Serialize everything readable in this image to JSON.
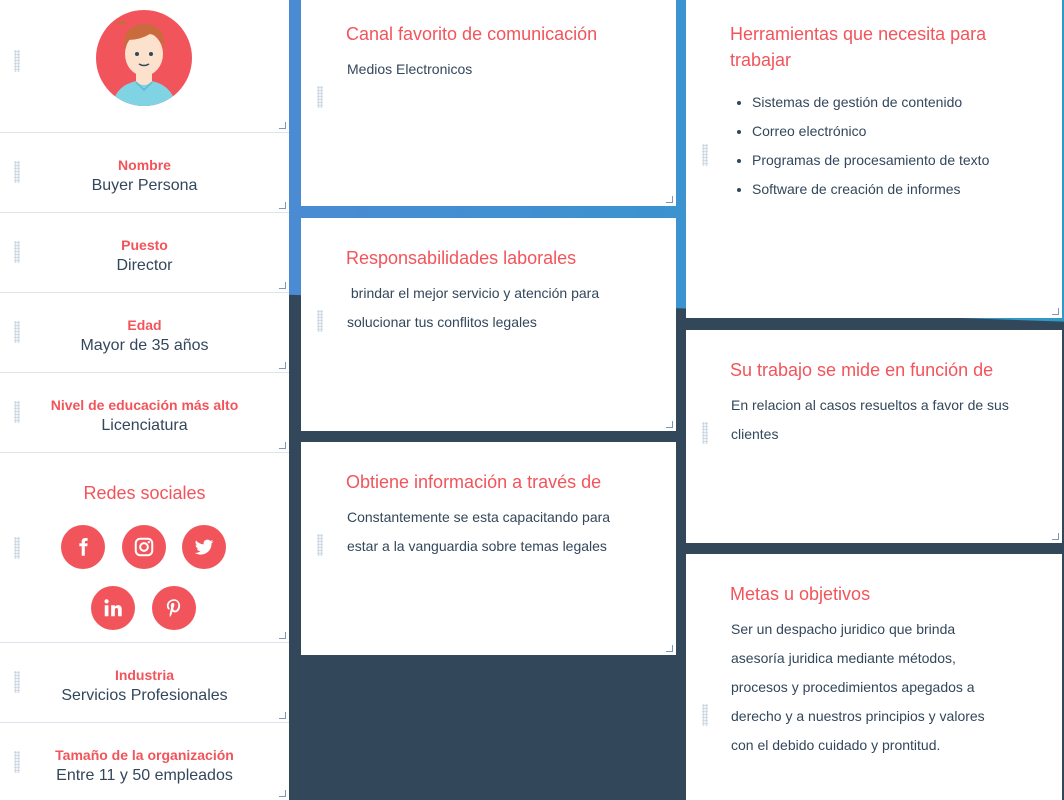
{
  "profile": {
    "fields": {
      "nombre": {
        "label": "Nombre",
        "value": "Buyer Persona"
      },
      "puesto": {
        "label": "Puesto",
        "value": "Director"
      },
      "edad": {
        "label": "Edad",
        "value": "Mayor de 35 años"
      },
      "educacion": {
        "label": "Nivel de educación más alto",
        "value": "Licenciatura"
      },
      "industria": {
        "label": "Industria",
        "value": "Servicios Profesionales"
      },
      "tamano": {
        "label": "Tamaño de la organización",
        "value": "Entre 11 y 50 empleados"
      }
    },
    "social": {
      "title": "Redes sociales",
      "icons": [
        "facebook-icon",
        "instagram-icon",
        "twitter-icon",
        "linkedin-icon",
        "pinterest-icon"
      ]
    }
  },
  "cards": {
    "canal": {
      "title": "Canal favorito de comunicación",
      "text": "Medios Electronicos"
    },
    "responsabilidades": {
      "title": "Responsabilidades laborales",
      "line1": " brindar el mejor servicio y atención para",
      "line2": "solucionar tus conflitos legales"
    },
    "informacion": {
      "title": "Obtiene información a través de",
      "line1": "Constantemente se esta capacitando para",
      "line2": "estar a la vanguardia sobre temas legales"
    },
    "herramientas": {
      "title_line1": "Herramientas que necesita para",
      "title_line2": "trabajar",
      "items": [
        "Sistemas de gestión de contenido",
        "Correo electrónico",
        "Programas de procesamiento de texto",
        "Software de creación de informes"
      ]
    },
    "medicion": {
      "title": "Su trabajo se mide en función de",
      "line1": "En relacion al casos resueltos a favor de sus",
      "line2": "clientes"
    },
    "metas": {
      "title": "Metas u objetivos",
      "lines": [
        "Ser un despacho juridico que brinda",
        "asesoría juridica mediante métodos,",
        "procesos y procedimientos apegados a",
        "derecho y a nuestros principios y valores",
        "con el debido cuidado y prontitud."
      ]
    }
  },
  "colors": {
    "accent": "#f2545b",
    "text": "#33475b",
    "background": "#33475b",
    "gradient_start": "#4a8bd4",
    "gradient_end": "#2f9ac6"
  }
}
